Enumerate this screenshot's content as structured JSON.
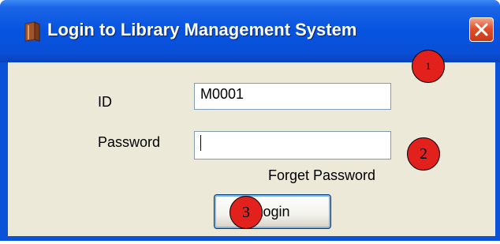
{
  "window": {
    "title": "Login to Library Management System",
    "close_icon": "close-icon",
    "app_icon": "book-icon"
  },
  "form": {
    "id_label": "ID",
    "id_value": "M0001",
    "password_label": "Password",
    "password_value": "",
    "forget_password": "Forget Password",
    "login_button": "Login"
  },
  "annotations": [
    "1",
    "2",
    "3"
  ],
  "colors": {
    "title_bar": "#0653e0",
    "dialog_bg": "#ece9d8",
    "marker": "#e2201c",
    "close_button": "#e0502a"
  }
}
